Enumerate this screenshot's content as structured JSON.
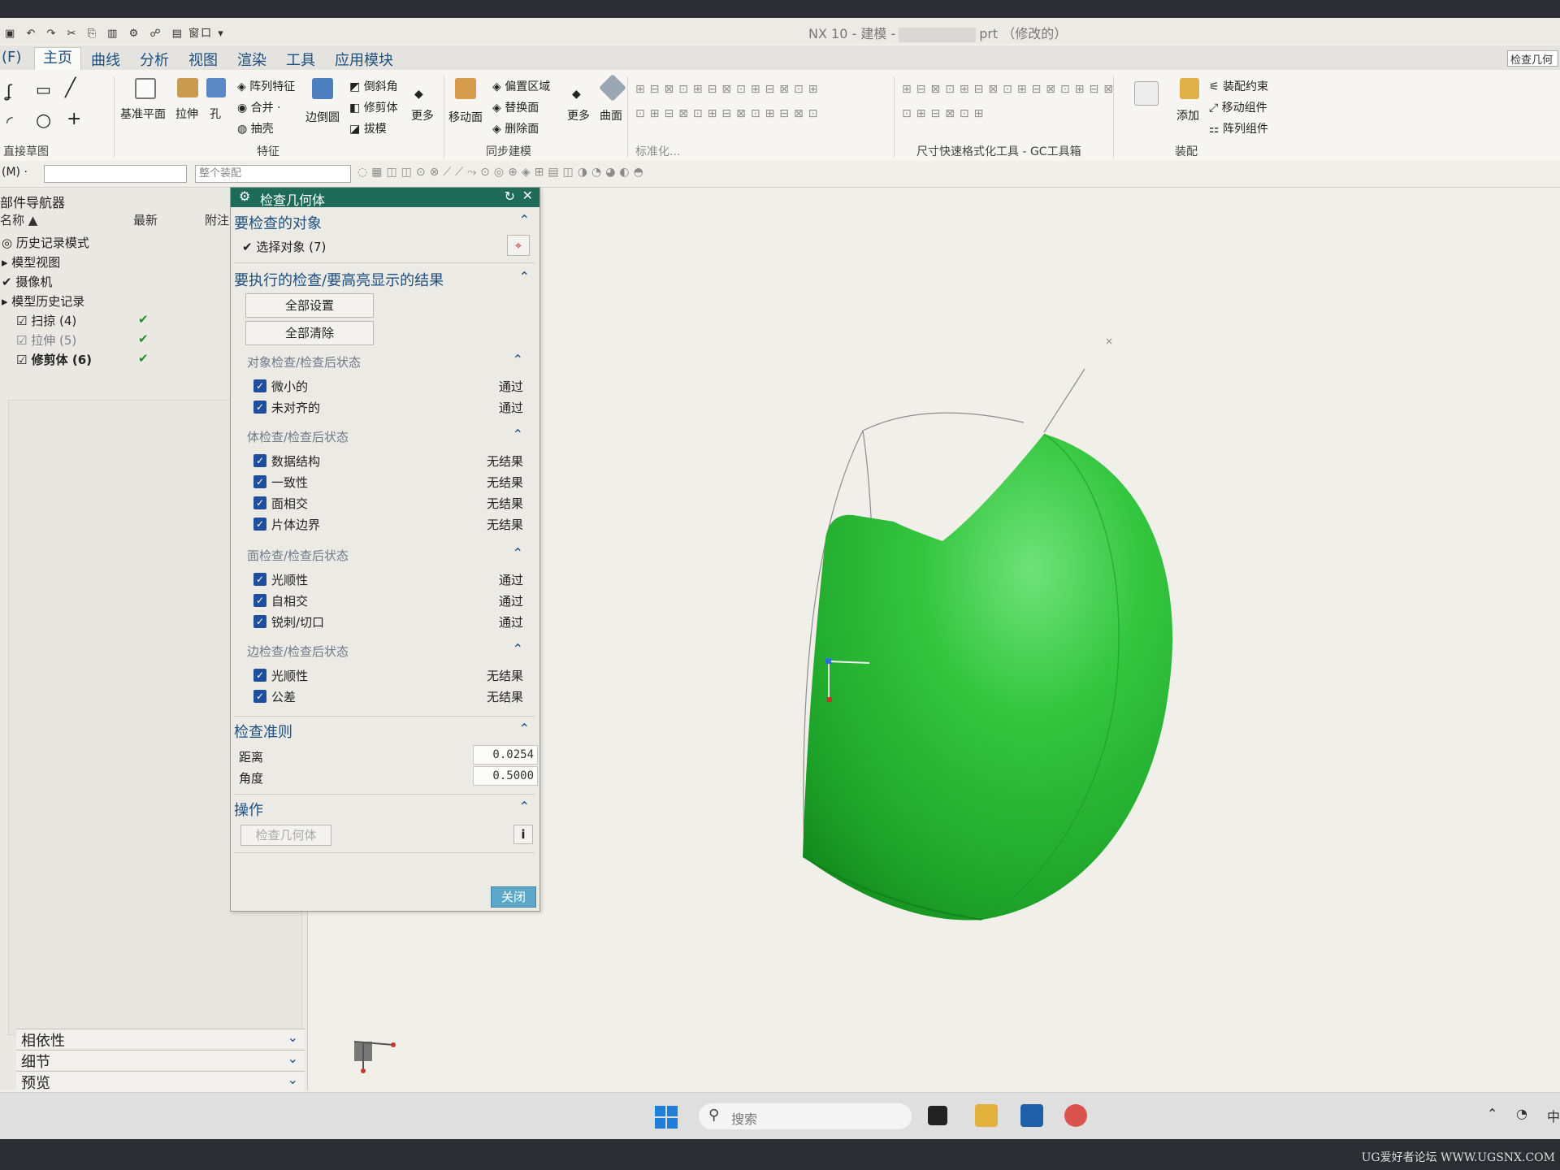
{
  "window": {
    "title_left": "NX 10 - 建模 -",
    "title_right": "prt （修改的）",
    "quick_access": [
      "▣",
      "↶",
      "↷",
      "✂",
      "⎘",
      "▥",
      "⚙",
      "☍",
      "▤ 窗口 ▾"
    ]
  },
  "menubar": {
    "file": "(F)",
    "tabs": [
      "主页",
      "曲线",
      "分析",
      "视图",
      "渲染",
      "工具",
      "应用模块"
    ],
    "search_command": "检查几何"
  },
  "ribbon": {
    "sketch_group": "直接草图",
    "feature_group": "特征",
    "sync_group": "同步建模",
    "standard_group": "标准化...",
    "tools_group": "尺寸快速格式化工具 - GC工具箱",
    "assembly_group": "装配",
    "datum_plane": "基准平面",
    "extrude": "拉伸",
    "hole": "孔",
    "pattern_feature": "阵列特征",
    "unite": "合并 ·",
    "shell": "抽壳",
    "edge_blend": "边倒圆",
    "chamfer": "倒斜角",
    "trim_body": "修剪体",
    "draft": "拔模",
    "more1": "更多",
    "move_face": "移动面",
    "offset_region": "偏置区域",
    "replace_face": "替换面",
    "delete_face": "删除面",
    "more2": "更多",
    "surface": "曲面",
    "add": "添加",
    "assembly_constraints": "装配约束",
    "move_component": "移动组件",
    "pattern_component": "阵列组件"
  },
  "selbar": {
    "filter_label": "(M) ·",
    "assembly_filter": "整个装配"
  },
  "navigator": {
    "title": "部件导航器",
    "col_name": "名称 ▲",
    "col_latest": "最新",
    "col_notes": "附注",
    "rows": [
      {
        "label": "◎ 历史记录模式",
        "check": ""
      },
      {
        "label": "▸ 模型视图",
        "check": ""
      },
      {
        "label": "✔ 摄像机",
        "check": ""
      },
      {
        "label": "▸ 模型历史记录",
        "check": ""
      },
      {
        "label": "☑ 扫掠 (4)",
        "check": "✔"
      },
      {
        "label": "☑ 拉伸 (5)",
        "check": "✔"
      },
      {
        "label": "☑ 修剪体 (6)",
        "check": "✔"
      }
    ],
    "accordion": [
      "相依性",
      "细节",
      "预览"
    ]
  },
  "dialog": {
    "title": "检查几何体",
    "sec_objects": "要检查的对象",
    "select_objects": "✔ 选择对象 (7)",
    "sec_checks": "要执行的检查/要高亮显示的结果",
    "set_all": "全部设置",
    "clear_all": "全部清除",
    "object_checks": "对象检查/检查后状态",
    "body_checks": "体检查/检查后状态",
    "face_checks": "面检查/检查后状态",
    "edge_checks": "边检查/检查后状态",
    "rows": [
      {
        "name": "微小的",
        "status": "通过"
      },
      {
        "name": "未对齐的",
        "status": "通过"
      },
      {
        "name": "数据结构",
        "status": "无结果"
      },
      {
        "name": "一致性",
        "status": "无结果"
      },
      {
        "name": "面相交",
        "status": "无结果"
      },
      {
        "name": "片体边界",
        "status": "无结果"
      },
      {
        "name": "光顺性",
        "status": "通过"
      },
      {
        "name": "自相交",
        "status": "通过"
      },
      {
        "name": "锐刺/切口",
        "status": "通过"
      },
      {
        "name": "光顺性",
        "status": "无结果"
      },
      {
        "name": "公差",
        "status": "无结果"
      }
    ],
    "sec_criteria": "检查准则",
    "distance_label": "距离",
    "distance_value": "0.0254",
    "angle_label": "角度",
    "angle_value": "0.5000",
    "sec_actions": "操作",
    "check_geometry_btn": "检查几何体",
    "close_btn": "关闭"
  },
  "taskbar": {
    "search_placeholder": "搜索",
    "ime": "中"
  },
  "watermark": "UG爱好者论坛 WWW.UGSNX.COM",
  "colors": {
    "body_green": "#2fbf3a",
    "dialog_header": "#1d6b58",
    "checkbox_blue": "#1e4f9c",
    "close_button": "#5aa7c7"
  }
}
